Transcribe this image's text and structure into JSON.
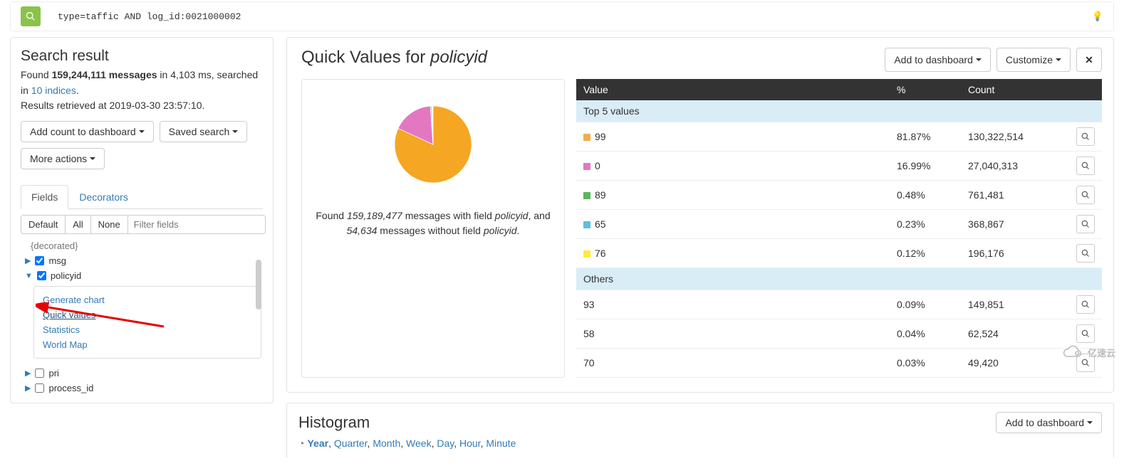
{
  "search": {
    "query": "type=taffic AND log_id:0021000002"
  },
  "search_result": {
    "title": "Search result",
    "found_prefix": "Found ",
    "count": "159,244,111 messages",
    "in_ms": " in 4,103 ms, searched",
    "in_prefix": "in ",
    "indices": "10 indices",
    "dot": ".",
    "retrieved": "Results retrieved at 2019-03-30 23:57:10.",
    "add_count_label": "Add count to dashboard ",
    "saved_search_label": "Saved search ",
    "more_actions_label": "More actions "
  },
  "tabs": {
    "fields": "Fields",
    "decorators": "Decorators"
  },
  "filters": {
    "default": "Default",
    "all": "All",
    "none": "None",
    "placeholder": "Filter fields"
  },
  "fields": {
    "decorated": "{decorated}",
    "msg": "msg",
    "policyid": "policyid",
    "pri": "pri",
    "process_id": "process_id"
  },
  "field_actions": {
    "generate_chart": "Generate chart",
    "quick_values": "Quick values",
    "statistics": "Statistics",
    "world_map": "World Map"
  },
  "quick_values": {
    "title_prefix": "Quick Values for ",
    "title_field": "policyid",
    "add_dash": "Add to dashboard ",
    "customize": "Customize ",
    "caption_pre": "Found ",
    "caption_with": "159,189,477",
    "caption_mid": " messages with field ",
    "caption_field1": "policyid",
    "caption_and": ", and ",
    "caption_without": "54,634",
    "caption_mid2": " messages without field ",
    "caption_field2": "policyid",
    "caption_dot": "."
  },
  "table": {
    "headers": {
      "value": "Value",
      "pct": "%",
      "count": "Count"
    },
    "top5_label": "Top 5 values",
    "others_label": "Others",
    "top5": [
      {
        "color": "#f0ad4e",
        "value": "99",
        "pct": "81.87%",
        "count": "130,322,514"
      },
      {
        "color": "#e377c2",
        "value": "0",
        "pct": "16.99%",
        "count": "27,040,313"
      },
      {
        "color": "#5cb85c",
        "value": "89",
        "pct": "0.48%",
        "count": "761,481"
      },
      {
        "color": "#5bc0de",
        "value": "65",
        "pct": "0.23%",
        "count": "368,867"
      },
      {
        "color": "#ffeb3b",
        "value": "76",
        "pct": "0.12%",
        "count": "196,176"
      }
    ],
    "others": [
      {
        "value": "93",
        "pct": "0.09%",
        "count": "149,851"
      },
      {
        "value": "58",
        "pct": "0.04%",
        "count": "62,524"
      },
      {
        "value": "70",
        "pct": "0.03%",
        "count": "49,420"
      }
    ]
  },
  "chart_data": {
    "type": "pie",
    "title": "Quick Values for policyid",
    "series": [
      {
        "name": "99",
        "value": 81.87,
        "color": "#f5a623"
      },
      {
        "name": "0",
        "value": 16.99,
        "color": "#e377c2"
      },
      {
        "name": "89",
        "value": 0.48,
        "color": "#5cb85c"
      },
      {
        "name": "65",
        "value": 0.23,
        "color": "#5bc0de"
      },
      {
        "name": "76",
        "value": 0.12,
        "color": "#ffeb3b"
      }
    ]
  },
  "histogram": {
    "title": "Histogram",
    "add_dash": "Add to dashboard ",
    "intervals": [
      "Year",
      "Quarter",
      "Month",
      "Week",
      "Day",
      "Hour",
      "Minute"
    ],
    "active": "Year"
  },
  "watermark": "亿速云"
}
